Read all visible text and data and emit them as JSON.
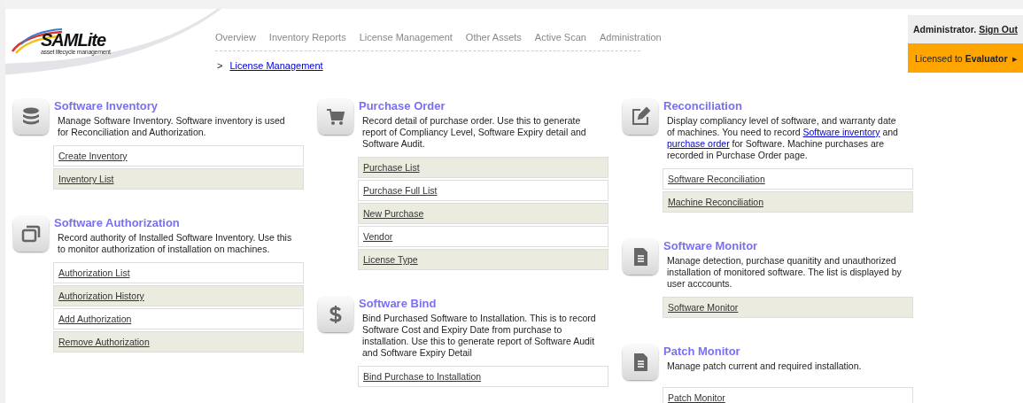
{
  "logo": {
    "name": "SAMLite",
    "tagline": "asset lifecycle management"
  },
  "nav": [
    {
      "label": "Overview"
    },
    {
      "label": "Inventory Reports"
    },
    {
      "label": "License Management"
    },
    {
      "label": "Other Assets"
    },
    {
      "label": "Active Scan"
    },
    {
      "label": "Administration"
    }
  ],
  "breadcrumb": {
    "arrow": ">",
    "link": "License Management"
  },
  "user": {
    "name": "Administrator.",
    "sign_out": "Sign Out",
    "license_prefix": "Licensed to",
    "licensee": "Evaluator",
    "arrow": "▸"
  },
  "columns": [
    {
      "sections": [
        {
          "title": "Software Inventory",
          "description": [
            {
              "text": "Manage Software Inventory. Software inventory is used for Reconciliation and Authorization.",
              "link": false
            }
          ],
          "links": [
            {
              "label": "Create Inventory",
              "shaded": false
            },
            {
              "label": "Inventory List",
              "shaded": true
            }
          ]
        },
        {
          "title": "Software Authorization",
          "description": [
            {
              "text": "Record authority of Installed Software Inventory. Use this to monitor authorization of installation on machines.",
              "link": false
            }
          ],
          "links": [
            {
              "label": "Authorization List",
              "shaded": false
            },
            {
              "label": "Authorization History",
              "shaded": true
            },
            {
              "label": "Add Authorization",
              "shaded": false
            },
            {
              "label": "Remove Authorization",
              "shaded": true
            }
          ]
        }
      ]
    },
    {
      "sections": [
        {
          "title": "Purchase Order",
          "description": [
            {
              "text": "Record detail of purchase order. Use this to generate report of Compliancy Level, Software Expiry detail and Software Audit.",
              "link": false
            }
          ],
          "links": [
            {
              "label": "Purchase List",
              "shaded": true
            },
            {
              "label": "Purchase Full List",
              "shaded": false
            },
            {
              "label": "New Purchase",
              "shaded": true
            },
            {
              "label": "Vendor",
              "shaded": false
            },
            {
              "label": "License Type",
              "shaded": true
            }
          ]
        },
        {
          "title": "Software Bind",
          "description": [
            {
              "text": "Bind Purchased Software to Installation. This is to record Software Cost and Expiry Date from purchase to installation. Use this to generate report of Software Audit and Software Expiry Detail",
              "link": false
            }
          ],
          "links": [
            {
              "label": "Bind Purchase to Installation",
              "shaded": false
            }
          ]
        }
      ]
    },
    {
      "sections": [
        {
          "title": "Reconciliation",
          "description": [
            {
              "text": "Display compliancy level of software, and warranty date of machines. You need to record ",
              "link": false
            },
            {
              "text": "Software inventory",
              "link": true
            },
            {
              "text": " and ",
              "link": false
            },
            {
              "text": "purchase order",
              "link": true
            },
            {
              "text": " for Software. Machine purchases are recorded in Purchase Order page.",
              "link": false
            }
          ],
          "links": [
            {
              "label": "Software Reconciliation",
              "shaded": false
            },
            {
              "label": "Machine Reconciliation",
              "shaded": true
            }
          ]
        },
        {
          "title": "Software Monitor",
          "description": [
            {
              "text": "Manage detection, purchase quanitity and unauthorized installation of monitored software. The list is displayed by user acccounts.",
              "link": false
            }
          ],
          "links": [
            {
              "label": "Software Monitor",
              "shaded": true
            }
          ]
        },
        {
          "title": "Patch Monitor",
          "description": [
            {
              "text": "Manage patch current and required installation.",
              "link": false
            }
          ],
          "links": [
            {
              "label": "Patch Monitor",
              "shaded": false
            }
          ]
        }
      ]
    }
  ]
}
